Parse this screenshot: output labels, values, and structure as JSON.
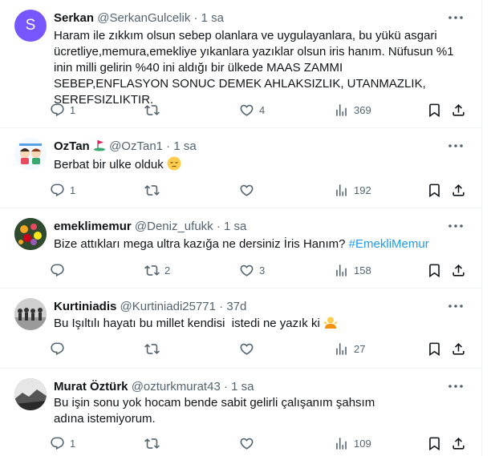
{
  "tweets": [
    {
      "avatar_letter": "S",
      "name": "Serkan",
      "handle": "@SerkanGulcelik",
      "sep": "·",
      "time": "1 sa",
      "text": "Haram ile zıkkım olsun sebep olanlara ve uygulayanlara, bu yükü asgari ücretliye,memura,emekliye yıkanlara yazıklar olsun iris hanım. Nüfusun %1 inin milli gelirin %40 ini aldığı bir ülkede MAAS ZAMMI SEBEP,ENFLASYON SONUC DEMEK AHLAKSIZLIK, UTANMAZLIK, SEREFSIZLIKTIR.",
      "replies": "1",
      "reposts": "",
      "likes": "4",
      "views": "369"
    },
    {
      "name": "OzTan",
      "name_badge_icon": "golf-flag-icon",
      "handle": "@OzTan1",
      "sep": "·",
      "time": "1 sa",
      "text": "Berbat bir ulke olduk",
      "text_emoji": "pensive-face-emoji",
      "replies": "1",
      "reposts": "",
      "likes": "",
      "views": "192"
    },
    {
      "name": "emeklimemur",
      "handle": "@Deniz_ufukk",
      "sep": "·",
      "time": "1 sa",
      "text": "Bize attıkları mega ultra kazığa ne dersiniz İris Hanım?",
      "hashtag": "#EmekliMemur",
      "replies": "",
      "reposts": "2",
      "likes": "3",
      "views": "158"
    },
    {
      "name": "Kurtiniadis",
      "handle": "@Kurtiniadi25771",
      "sep": "·",
      "time": "37d",
      "text": "Bu Işıltılı hayatı bu millet kendisi  istedi ne yazık ki",
      "text_emoji": "person-shrugging-emoji",
      "replies": "",
      "reposts": "",
      "likes": "",
      "views": "27"
    },
    {
      "name": "Murat Öztürk",
      "handle": "@ozturkmurat43",
      "sep": "·",
      "time": "1 sa",
      "text": "Bu işin sonu yok hocam bende sabit gelirli çalışanım şahsım adına istemiyorum.",
      "replies": "1",
      "reposts": "",
      "likes": "",
      "views": "109"
    }
  ],
  "colors": {
    "text": "#0f1419",
    "muted": "#536471",
    "link": "#1d9bf0",
    "border": "#eff3f4",
    "avatar_s": "#7856ff"
  }
}
